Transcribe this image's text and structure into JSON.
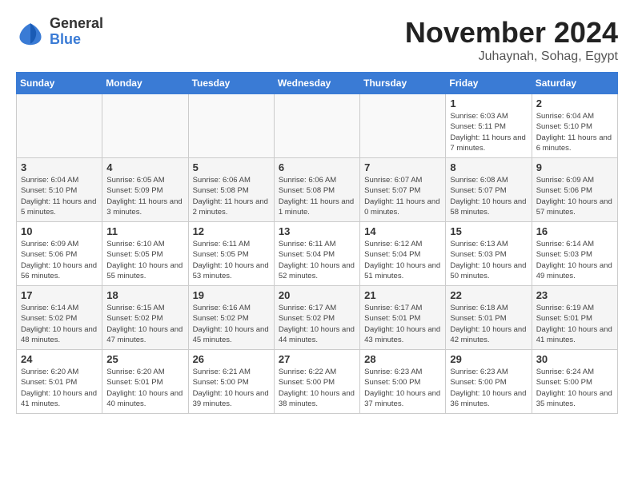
{
  "header": {
    "logo_general": "General",
    "logo_blue": "Blue",
    "month_title": "November 2024",
    "location": "Juhaynah, Sohag, Egypt"
  },
  "weekdays": [
    "Sunday",
    "Monday",
    "Tuesday",
    "Wednesday",
    "Thursday",
    "Friday",
    "Saturday"
  ],
  "weeks": [
    [
      {
        "day": "",
        "empty": true
      },
      {
        "day": "",
        "empty": true
      },
      {
        "day": "",
        "empty": true
      },
      {
        "day": "",
        "empty": true
      },
      {
        "day": "",
        "empty": true
      },
      {
        "day": "1",
        "sunrise": "Sunrise: 6:03 AM",
        "sunset": "Sunset: 5:11 PM",
        "daylight": "Daylight: 11 hours and 7 minutes."
      },
      {
        "day": "2",
        "sunrise": "Sunrise: 6:04 AM",
        "sunset": "Sunset: 5:10 PM",
        "daylight": "Daylight: 11 hours and 6 minutes."
      }
    ],
    [
      {
        "day": "3",
        "sunrise": "Sunrise: 6:04 AM",
        "sunset": "Sunset: 5:10 PM",
        "daylight": "Daylight: 11 hours and 5 minutes."
      },
      {
        "day": "4",
        "sunrise": "Sunrise: 6:05 AM",
        "sunset": "Sunset: 5:09 PM",
        "daylight": "Daylight: 11 hours and 3 minutes."
      },
      {
        "day": "5",
        "sunrise": "Sunrise: 6:06 AM",
        "sunset": "Sunset: 5:08 PM",
        "daylight": "Daylight: 11 hours and 2 minutes."
      },
      {
        "day": "6",
        "sunrise": "Sunrise: 6:06 AM",
        "sunset": "Sunset: 5:08 PM",
        "daylight": "Daylight: 11 hours and 1 minute."
      },
      {
        "day": "7",
        "sunrise": "Sunrise: 6:07 AM",
        "sunset": "Sunset: 5:07 PM",
        "daylight": "Daylight: 11 hours and 0 minutes."
      },
      {
        "day": "8",
        "sunrise": "Sunrise: 6:08 AM",
        "sunset": "Sunset: 5:07 PM",
        "daylight": "Daylight: 10 hours and 58 minutes."
      },
      {
        "day": "9",
        "sunrise": "Sunrise: 6:09 AM",
        "sunset": "Sunset: 5:06 PM",
        "daylight": "Daylight: 10 hours and 57 minutes."
      }
    ],
    [
      {
        "day": "10",
        "sunrise": "Sunrise: 6:09 AM",
        "sunset": "Sunset: 5:06 PM",
        "daylight": "Daylight: 10 hours and 56 minutes."
      },
      {
        "day": "11",
        "sunrise": "Sunrise: 6:10 AM",
        "sunset": "Sunset: 5:05 PM",
        "daylight": "Daylight: 10 hours and 55 minutes."
      },
      {
        "day": "12",
        "sunrise": "Sunrise: 6:11 AM",
        "sunset": "Sunset: 5:05 PM",
        "daylight": "Daylight: 10 hours and 53 minutes."
      },
      {
        "day": "13",
        "sunrise": "Sunrise: 6:11 AM",
        "sunset": "Sunset: 5:04 PM",
        "daylight": "Daylight: 10 hours and 52 minutes."
      },
      {
        "day": "14",
        "sunrise": "Sunrise: 6:12 AM",
        "sunset": "Sunset: 5:04 PM",
        "daylight": "Daylight: 10 hours and 51 minutes."
      },
      {
        "day": "15",
        "sunrise": "Sunrise: 6:13 AM",
        "sunset": "Sunset: 5:03 PM",
        "daylight": "Daylight: 10 hours and 50 minutes."
      },
      {
        "day": "16",
        "sunrise": "Sunrise: 6:14 AM",
        "sunset": "Sunset: 5:03 PM",
        "daylight": "Daylight: 10 hours and 49 minutes."
      }
    ],
    [
      {
        "day": "17",
        "sunrise": "Sunrise: 6:14 AM",
        "sunset": "Sunset: 5:02 PM",
        "daylight": "Daylight: 10 hours and 48 minutes."
      },
      {
        "day": "18",
        "sunrise": "Sunrise: 6:15 AM",
        "sunset": "Sunset: 5:02 PM",
        "daylight": "Daylight: 10 hours and 47 minutes."
      },
      {
        "day": "19",
        "sunrise": "Sunrise: 6:16 AM",
        "sunset": "Sunset: 5:02 PM",
        "daylight": "Daylight: 10 hours and 45 minutes."
      },
      {
        "day": "20",
        "sunrise": "Sunrise: 6:17 AM",
        "sunset": "Sunset: 5:02 PM",
        "daylight": "Daylight: 10 hours and 44 minutes."
      },
      {
        "day": "21",
        "sunrise": "Sunrise: 6:17 AM",
        "sunset": "Sunset: 5:01 PM",
        "daylight": "Daylight: 10 hours and 43 minutes."
      },
      {
        "day": "22",
        "sunrise": "Sunrise: 6:18 AM",
        "sunset": "Sunset: 5:01 PM",
        "daylight": "Daylight: 10 hours and 42 minutes."
      },
      {
        "day": "23",
        "sunrise": "Sunrise: 6:19 AM",
        "sunset": "Sunset: 5:01 PM",
        "daylight": "Daylight: 10 hours and 41 minutes."
      }
    ],
    [
      {
        "day": "24",
        "sunrise": "Sunrise: 6:20 AM",
        "sunset": "Sunset: 5:01 PM",
        "daylight": "Daylight: 10 hours and 41 minutes."
      },
      {
        "day": "25",
        "sunrise": "Sunrise: 6:20 AM",
        "sunset": "Sunset: 5:01 PM",
        "daylight": "Daylight: 10 hours and 40 minutes."
      },
      {
        "day": "26",
        "sunrise": "Sunrise: 6:21 AM",
        "sunset": "Sunset: 5:00 PM",
        "daylight": "Daylight: 10 hours and 39 minutes."
      },
      {
        "day": "27",
        "sunrise": "Sunrise: 6:22 AM",
        "sunset": "Sunset: 5:00 PM",
        "daylight": "Daylight: 10 hours and 38 minutes."
      },
      {
        "day": "28",
        "sunrise": "Sunrise: 6:23 AM",
        "sunset": "Sunset: 5:00 PM",
        "daylight": "Daylight: 10 hours and 37 minutes."
      },
      {
        "day": "29",
        "sunrise": "Sunrise: 6:23 AM",
        "sunset": "Sunset: 5:00 PM",
        "daylight": "Daylight: 10 hours and 36 minutes."
      },
      {
        "day": "30",
        "sunrise": "Sunrise: 6:24 AM",
        "sunset": "Sunset: 5:00 PM",
        "daylight": "Daylight: 10 hours and 35 minutes."
      }
    ]
  ]
}
